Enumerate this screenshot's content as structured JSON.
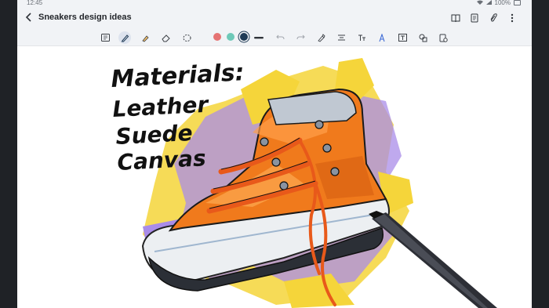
{
  "status": {
    "time": "12:45",
    "battery": "100%"
  },
  "app": {
    "title": "Sneakers design ideas"
  },
  "toolbar": {
    "tools": [
      "text-mode",
      "pen",
      "highlighter",
      "eraser",
      "lasso"
    ],
    "active_tool": "pen",
    "colors": [
      "#e57373",
      "#6ec9b8",
      "#1f3a55"
    ],
    "selected_color": "#1f3a55"
  },
  "note": {
    "lines": [
      "Materials:",
      "Leather",
      "Suede",
      "Canvas"
    ]
  },
  "colors": {
    "chrome": "#f1f3f6",
    "ink": "#111111",
    "shoe_orange": "#f07a1c",
    "splash_yellow": "#f5d53a",
    "splash_purple": "#a98ce8"
  }
}
